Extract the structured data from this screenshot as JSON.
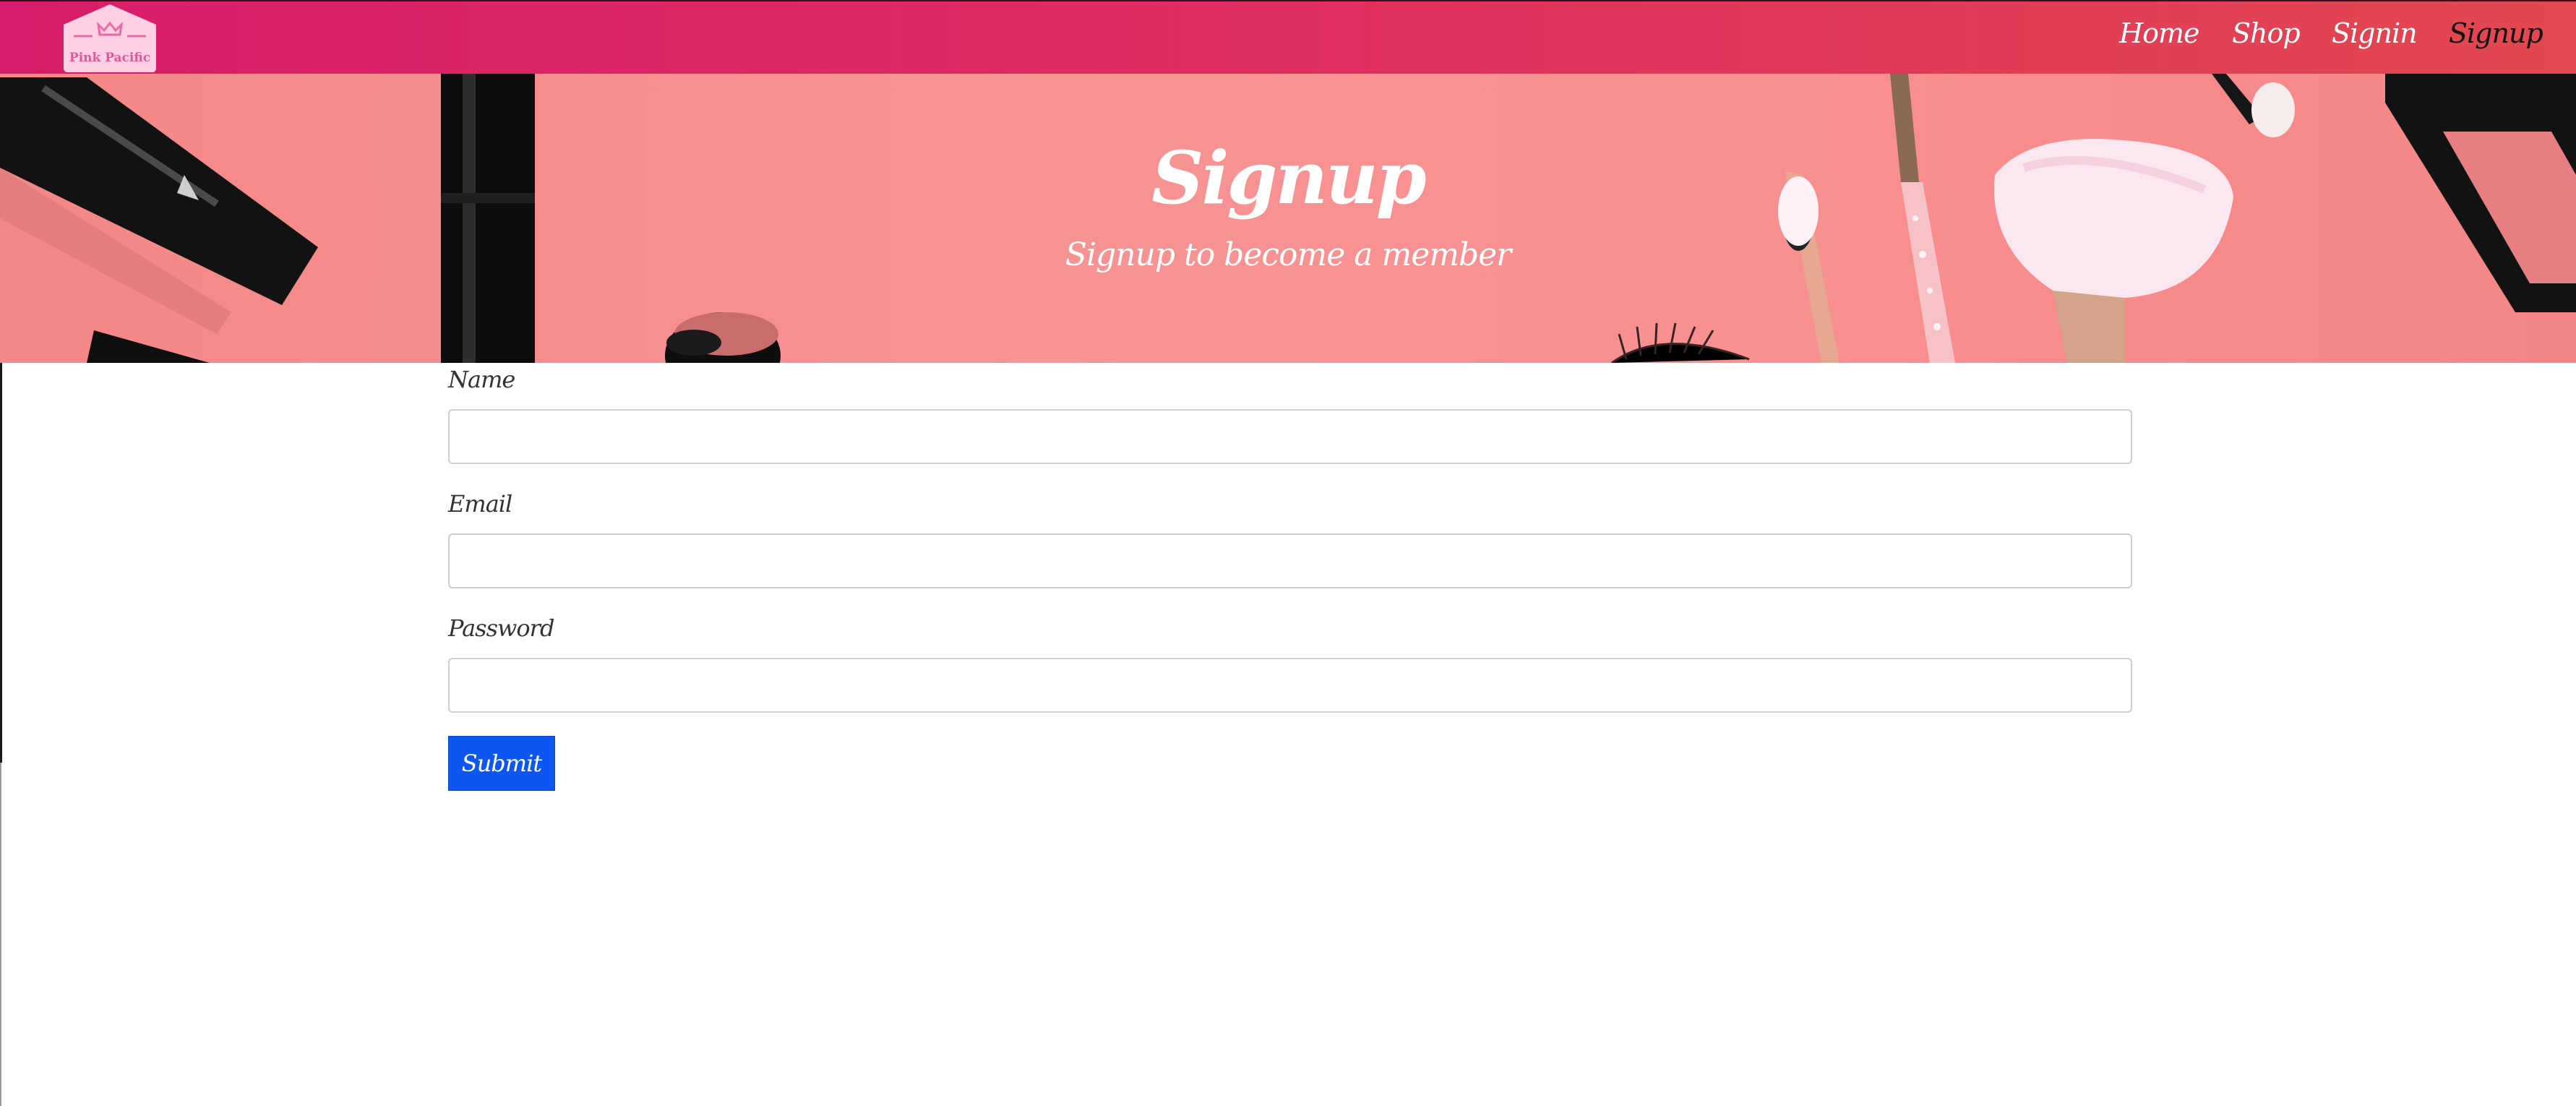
{
  "brand": {
    "logo_text": "Pink Pacific",
    "logo_icon": "crown-icon",
    "colors": {
      "navbar_start": "#d81c6b",
      "navbar_end": "#e2484f",
      "logo_bg": "#ffd0e4"
    }
  },
  "nav": {
    "items": [
      {
        "label": "Home",
        "active": false
      },
      {
        "label": "Shop",
        "active": false
      },
      {
        "label": "Signin",
        "active": false
      },
      {
        "label": "Signup",
        "active": true
      }
    ]
  },
  "hero": {
    "title": "Signup",
    "subtitle": "Signup to become a member",
    "background": "makeup-flatlay-image",
    "background_color": "#f79393"
  },
  "form": {
    "fields": [
      {
        "label": "Name",
        "value": "",
        "placeholder": ""
      },
      {
        "label": "Email",
        "value": "",
        "placeholder": ""
      },
      {
        "label": "Password",
        "value": "",
        "placeholder": ""
      }
    ],
    "submit_label": "Submit",
    "submit_color": "#0d57f0"
  }
}
